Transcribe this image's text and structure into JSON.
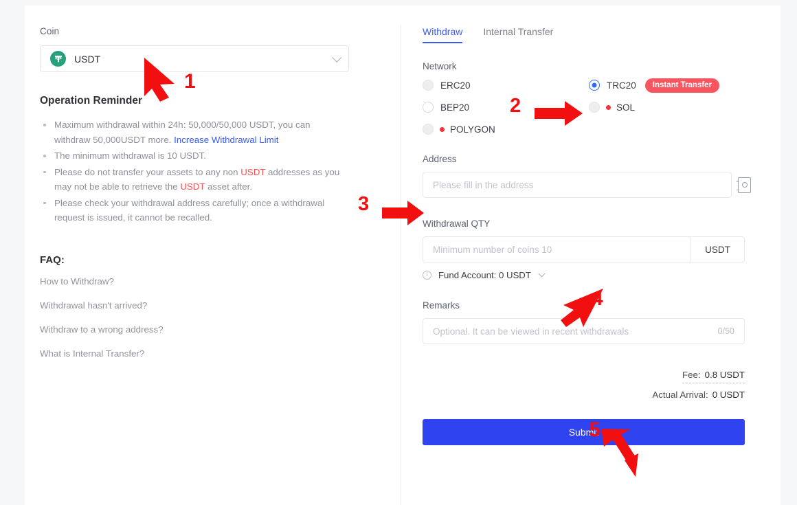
{
  "left_panel": {
    "coin_label": "Coin",
    "coin_value": "USDT",
    "coin_icon": "tether-logo-icon",
    "reminder_title": "Operation Reminder",
    "reminders": [
      {
        "parts": [
          {
            "t": "Maximum withdrawal within 24h: 50,000/50,000 USDT, you can withdraw 50,000USDT more. ",
            "style": "plain"
          },
          {
            "t": "Increase Withdrawal Limit",
            "style": "link"
          }
        ]
      },
      {
        "parts": [
          {
            "t": "The minimum withdrawal is 10 USDT.",
            "style": "plain"
          }
        ]
      },
      {
        "parts": [
          {
            "t": "Please do not transfer your assets to any non ",
            "style": "plain"
          },
          {
            "t": "USDT",
            "style": "highlight"
          },
          {
            "t": " addresses as you may not be able to retrieve the ",
            "style": "plain"
          },
          {
            "t": "USDT",
            "style": "highlight"
          },
          {
            "t": " asset after.",
            "style": "plain"
          }
        ]
      },
      {
        "parts": [
          {
            "t": "Please check your withdrawal address carefully; once a withdrawal request is issued, it cannot be recalled.",
            "style": "plain"
          }
        ]
      }
    ],
    "faq_title": "FAQ:",
    "faq_items": [
      "How to Withdraw?",
      "Withdrawal hasn't arrived?",
      "Withdraw to a wrong address?",
      "What is Internal Transfer?"
    ]
  },
  "right_panel": {
    "tabs": [
      {
        "label": "Withdraw",
        "active": true
      },
      {
        "label": "Internal Transfer",
        "active": false
      }
    ],
    "network_label": "Network",
    "networks": [
      {
        "name": "ERC20",
        "state": "disabled",
        "dot": false,
        "badge": null
      },
      {
        "name": "TRC20",
        "state": "checked",
        "dot": false,
        "badge": "Instant Transfer"
      },
      {
        "name": "BEP20",
        "state": "empty",
        "dot": false,
        "badge": null
      },
      {
        "name": "SOL",
        "state": "disabled",
        "dot": true,
        "badge": null
      },
      {
        "name": "POLYGON",
        "state": "disabled",
        "dot": true,
        "badge": null
      }
    ],
    "address_label": "Address",
    "address_placeholder": "Please fill in the address",
    "address_value": "",
    "address_book_icon": "address-book-icon",
    "qty_label": "Withdrawal QTY",
    "qty_placeholder": "Minimum number of coins 10",
    "qty_value": "",
    "qty_unit": "USDT",
    "fund_account": "Fund Account: 0 USDT",
    "remarks_label": "Remarks",
    "remarks_placeholder": "Optional. It can be viewed in recent withdrawals",
    "remarks_value": "",
    "remarks_counter": "0/50",
    "fee_label": "Fee:",
    "fee_value": "0.8 USDT",
    "arrival_label": "Actual Arrival:",
    "arrival_value": "0 USDT",
    "submit_label": "Submit"
  },
  "annotations": {
    "color": "#f10f0f",
    "steps": [
      {
        "num": "1",
        "target": "coin-select"
      },
      {
        "num": "2",
        "target": "trc20-radio"
      },
      {
        "num": "3",
        "target": "address-input"
      },
      {
        "num": "4",
        "target": "qty-input"
      },
      {
        "num": "5",
        "target": "submit-button"
      }
    ]
  }
}
